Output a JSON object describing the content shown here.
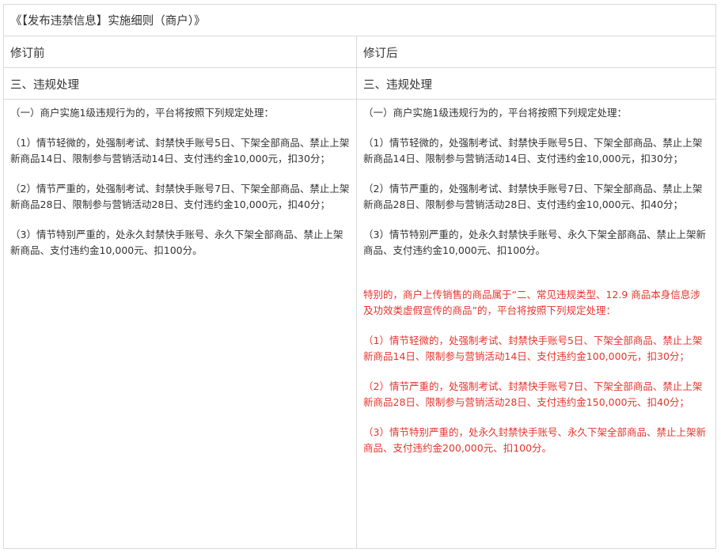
{
  "title": "《【发布违禁信息】实施细则（商户）》",
  "headers": {
    "before": "修订前",
    "after": "修订后"
  },
  "section": {
    "before": "三、违规处理",
    "after": "三、违规处理"
  },
  "before_paragraphs": [
    "（一）商户实施1级违规行为的，平台将按照下列规定处理：",
    "（1）情节轻微的，处强制考试、封禁快手账号5日、下架全部商品、禁止上架新商品14日、限制参与营销活动14日、支付违约金10,000元，扣30分；",
    "（2）情节严重的，处强制考试、封禁快手账号7日、下架全部商品、禁止上架新商品28日、限制参与营销活动28日、支付违约金10,000元，扣40分；",
    "（3）情节特别严重的，处永久封禁快手账号、永久下架全部商品、禁止上架新商品、支付违约金10,000元、扣100分。"
  ],
  "after_paragraphs": [
    "（一）商户实施1级违规行为的，平台将按照下列规定处理：",
    "（1）情节轻微的，处强制考试、封禁快手账号5日、下架全部商品、禁止上架新商品14日、限制参与营销活动14日、支付违约金10,000元，扣30分；",
    "（2）情节严重的，处强制考试、封禁快手账号7日、下架全部商品、禁止上架新商品28日、限制参与营销活动28日、支付违约金10,000元、扣40分；",
    "（3）情节特别严重的，处永久封禁快手账号、永久下架全部商品、禁止上架新商品、支付违约金10,000元、扣100分。"
  ],
  "after_added_paragraphs": [
    "特别的，商户上传销售的商品属于“二、常见违规类型、12.9 商品本身信息涉及功效类虚假宣传的商品”的，平台将按照下列规定处理：",
    "（1）情节轻微的，处强制考试、封禁快手账号5日、下架全部商品、禁止上架新商品14日、限制参与营销活动14日、支付违约金100,000元，扣30分；",
    "（2）情节严重的，处强制考试、封禁快手账号7日、下架全部商品、禁止上架新商品28日、限制参与营销活动28日、支付违约金150,000元、扣40分；",
    "（3）情节特别严重的，处永久封禁快手账号、永久下架全部商品、禁止上架新商品、支付违约金200,000元、扣100分。"
  ],
  "colors": {
    "text": "#333333",
    "added_text": "#e8342c",
    "border": "#d9d9d9"
  }
}
